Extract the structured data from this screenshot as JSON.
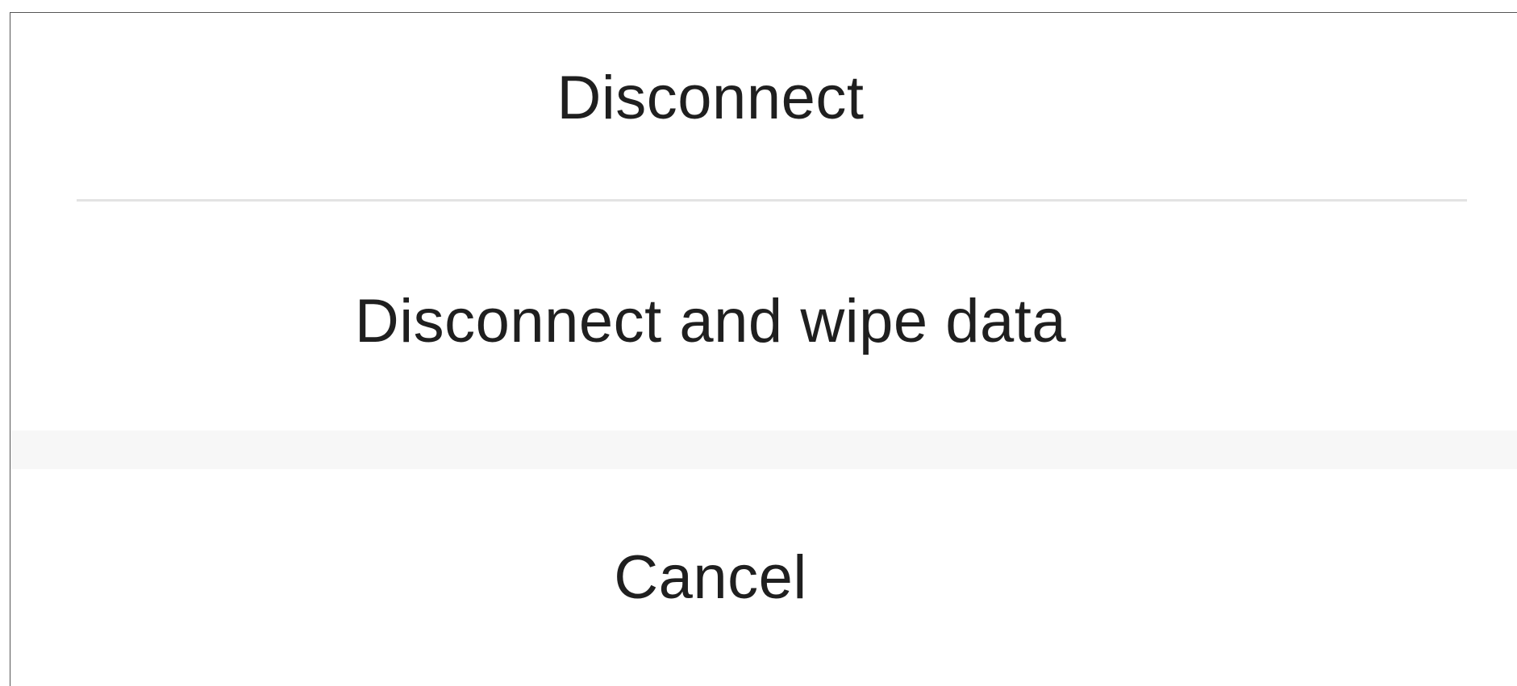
{
  "dialog": {
    "options": {
      "disconnect_label": "Disconnect",
      "disconnect_wipe_label": "Disconnect and wipe data"
    },
    "cancel_label": "Cancel"
  },
  "colors": {
    "background": "#ffffff",
    "text": "#1f1f1f",
    "divider": "#e3e3e3",
    "separator_band": "#f7f7f7"
  }
}
